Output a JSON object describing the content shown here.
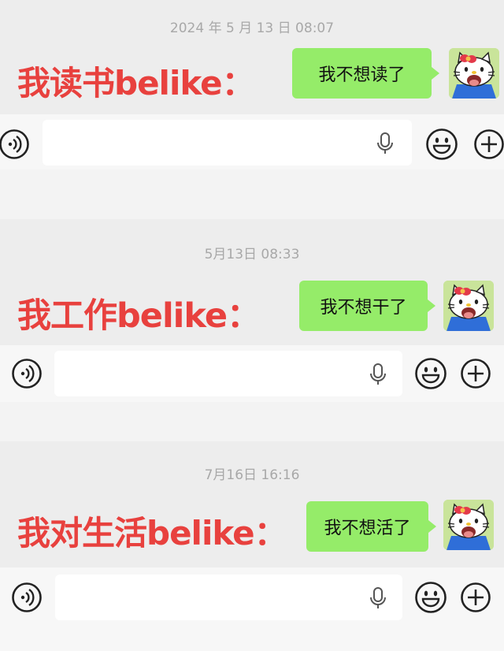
{
  "panels": [
    {
      "timestamp": "2024 年 5 月 13 日 08:07",
      "caption": "我读书belike：",
      "message": "我不想读了"
    },
    {
      "timestamp": "5月13日 08:33",
      "caption": "我工作belike：",
      "message": "我不想干了"
    },
    {
      "timestamp": "7月16日 16:16",
      "caption": "我对生活belike：",
      "message": "我不想活了"
    }
  ],
  "icons": {
    "voice": "voice-toggle-icon",
    "mic": "microphone-icon",
    "emoji": "emoji-icon",
    "plus": "plus-icon",
    "avatar": "hello-kitty-avatar"
  },
  "colors": {
    "bubble": "#95ec69",
    "caption": "#e8413e",
    "timestamp": "#a8a8a8",
    "background": "#ededed",
    "input_bar": "#f7f7f7"
  }
}
